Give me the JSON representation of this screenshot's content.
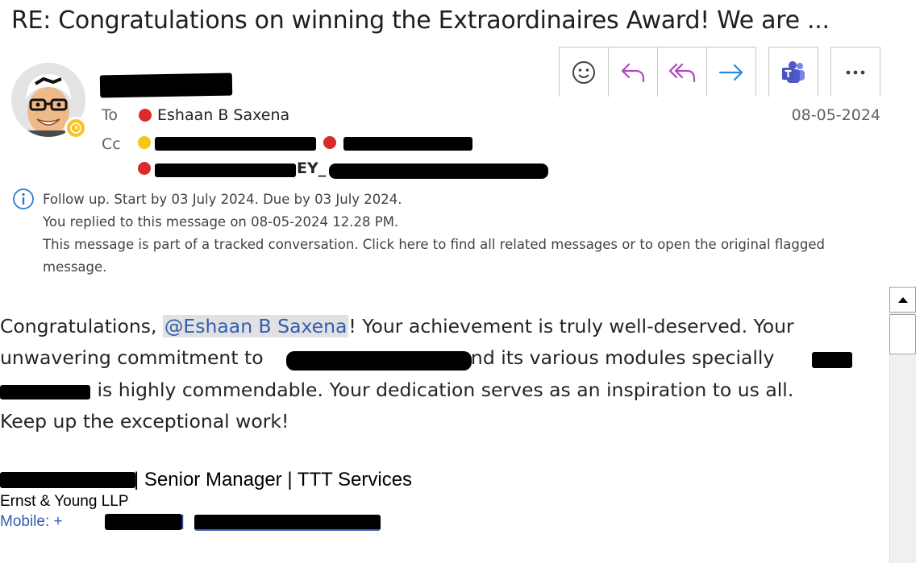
{
  "email": {
    "subject": "RE: Congratulations on winning the Extraordinaires Award! We are ...",
    "to_label": "To",
    "cc_label": "Cc",
    "to_recipient": "Eshaan B Saxena",
    "cc_visible_text": "EY_",
    "date": "08-05-2024"
  },
  "toolbar": {
    "buttons": [
      "emoji-icon",
      "reply-icon",
      "reply-all-icon",
      "forward-icon",
      "teams-icon",
      "more-icon"
    ]
  },
  "info": {
    "line1": "Follow up.  Start by 03 July 2024.  Due by 03 July 2024.",
    "line2": "You replied to this message on 08-05-2024 12.28 PM.",
    "line3": "This message is part of a tracked conversation. Click here to find all related messages or to open the original flagged",
    "line4": "message."
  },
  "body": {
    "line1_prefix": "Congratulations, ",
    "mention": "@Eshaan B Saxena",
    "line1_suffix": "! Your achievement is truly well-deserved. Your",
    "line2_a": "unwavering commitment to ",
    "line2_b": " and its various modules specially ",
    "line3": " is highly commendable. Your dedication serves as an inspiration to us all.",
    "line4": "Keep up the exceptional work!"
  },
  "signature": {
    "title_line": "| Senior Manager | TTT Services",
    "company": "Ernst & Young LLP",
    "mobile_label": "Mobile: +",
    "separator": " | "
  },
  "colors": {
    "presence_busy": "#d92b2b",
    "presence_away": "#f5c518",
    "reply_accent": "#b146c2",
    "forward_accent": "#2b88d8",
    "teams": "#5059c9",
    "mention_text": "#2f5eb4",
    "link": "#2f5eb4"
  }
}
